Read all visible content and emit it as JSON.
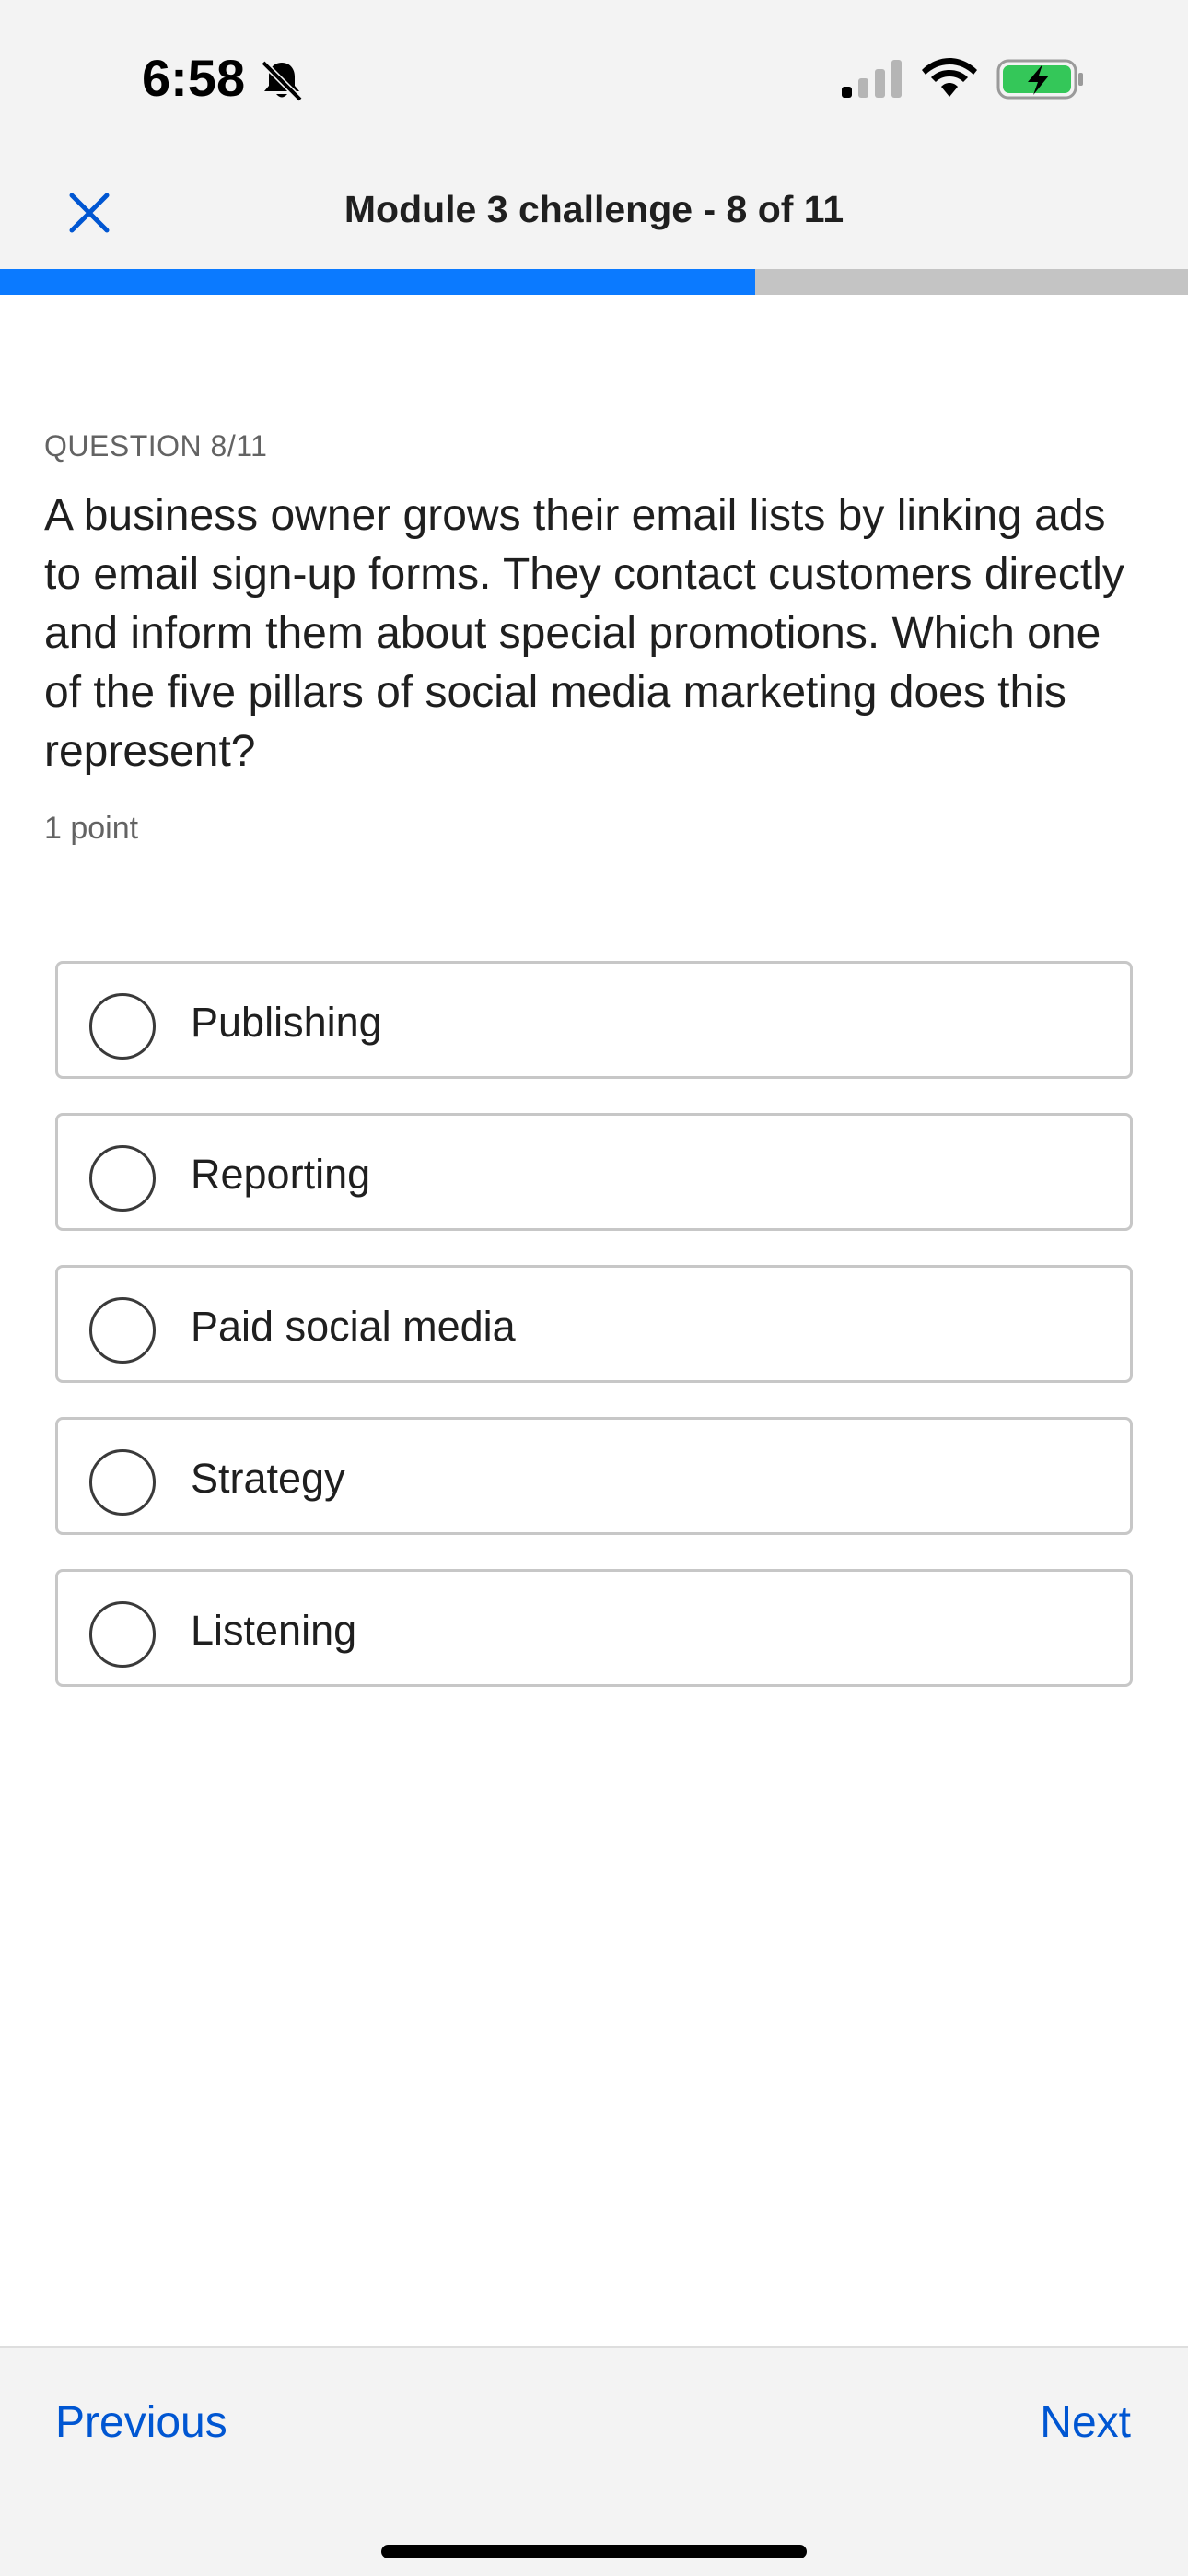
{
  "status_bar": {
    "time": "6:58",
    "icons": [
      "bell-off-icon",
      "cellular-signal-icon",
      "wifi-icon",
      "battery-charging-icon"
    ],
    "battery_color": "#34c759"
  },
  "header": {
    "close_icon": "close-icon",
    "title": "Module 3 challenge - 8 of 11"
  },
  "progress": {
    "fraction": 0.636,
    "fill_color": "#0b7aff",
    "track_color": "#c4c4c4"
  },
  "question": {
    "label": "QUESTION 8/11",
    "text": "A business owner grows their email lists by linking ads to email sign-up forms. They contact customers directly and inform them about special promotions. Which one of the five pillars of social media marketing does this represent?",
    "points": "1 point",
    "options": [
      {
        "label": "Publishing",
        "selected": false
      },
      {
        "label": "Reporting",
        "selected": false
      },
      {
        "label": "Paid social media",
        "selected": false
      },
      {
        "label": "Strategy",
        "selected": false
      },
      {
        "label": "Listening",
        "selected": false
      }
    ]
  },
  "footer": {
    "previous_label": "Previous",
    "next_label": "Next",
    "link_color": "#0056d2"
  }
}
